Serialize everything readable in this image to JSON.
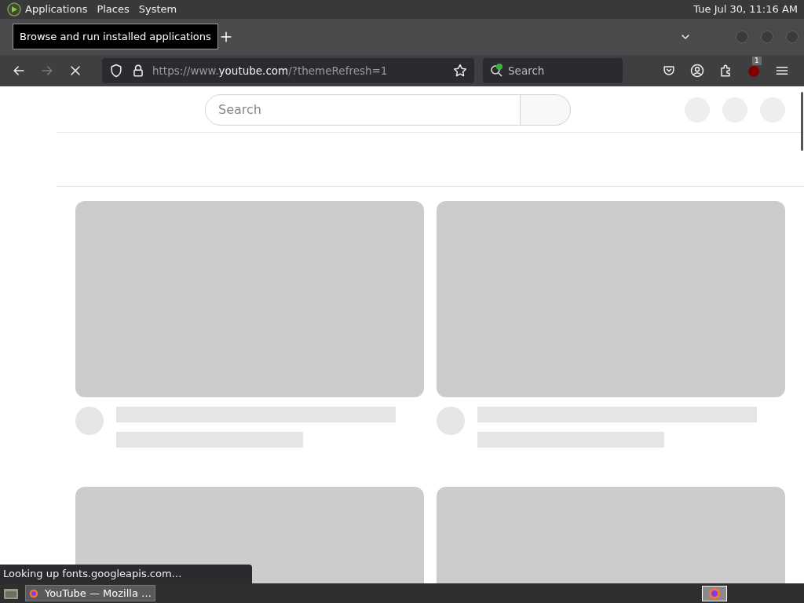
{
  "top_panel": {
    "menus": [
      "Applications",
      "Places",
      "System"
    ],
    "clock": "Tue Jul 30, 11:16 AM"
  },
  "tooltip": "Browse and run installed applications",
  "browser": {
    "url": {
      "prefix": "https://www.",
      "domain": "youtube.com",
      "suffix": "/?themeRefresh=1"
    },
    "search_placeholder": "Search",
    "extension_badge": "1",
    "forward_disabled": true
  },
  "page": {
    "search_placeholder": "Search"
  },
  "status": "Looking up fonts.googleapis.com…",
  "taskbar": {
    "windows": [
      {
        "title": "YouTube — Mozilla …",
        "selected": true
      }
    ]
  }
}
